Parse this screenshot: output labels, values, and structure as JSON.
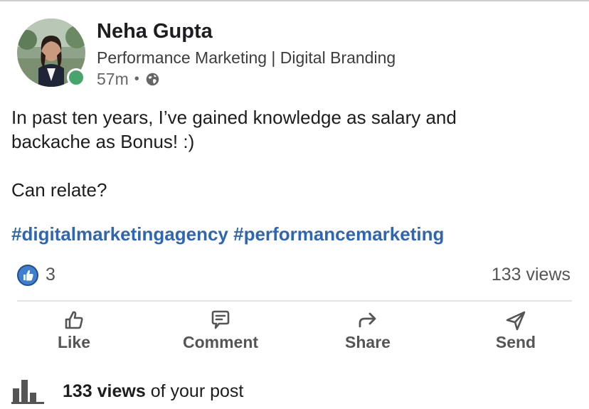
{
  "post": {
    "author": {
      "name": "Neha Gupta",
      "headline": "Performance Marketing | Digital Branding",
      "time": "57m",
      "separator": "•",
      "visibility_icon": "globe-icon",
      "presence_color": "#47a46b"
    },
    "body": {
      "line1": "In past ten years, I’ve gained knowledge as salary and",
      "line2": "backache as Bonus! :)",
      "line3": "Can relate?"
    },
    "hashtags": [
      "#digitalmarketingagency",
      "#performancemarketing"
    ],
    "link_color": "#2f66b3"
  },
  "stats": {
    "reaction_icon": "like-reaction-icon",
    "reaction_count": "3",
    "views": "133 views"
  },
  "actions": [
    {
      "label": "Like",
      "icon": "thumbs-up-icon"
    },
    {
      "label": "Comment",
      "icon": "comment-icon"
    },
    {
      "label": "Share",
      "icon": "share-arrow-icon"
    },
    {
      "label": "Send",
      "icon": "send-icon"
    }
  ],
  "footer": {
    "icon": "bar-chart-icon",
    "bold": "133 views",
    "rest": " of your post"
  }
}
